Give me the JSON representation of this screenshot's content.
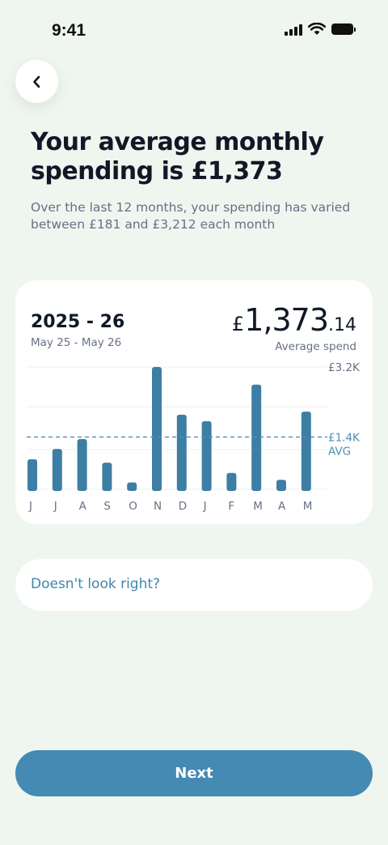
{
  "status_bar": {
    "time": "9:41"
  },
  "header": {
    "title": "Your average monthly spending is £1,373",
    "subtitle": "Over the last 12 months, your spending has varied between £181 and £3,212 each month"
  },
  "card": {
    "period_title": "2025 - 26",
    "period_range": "May 25 - May 26",
    "amount_currency": "£",
    "amount_main": "1,373",
    "amount_decimal": ".14",
    "amount_label": "Average spend"
  },
  "chart_data": {
    "type": "bar",
    "categories": [
      "J",
      "J",
      "A",
      "S",
      "O",
      "N",
      "D",
      "J",
      "F",
      "M",
      "A",
      "M"
    ],
    "values": [
      790,
      1060,
      1320,
      700,
      181,
      3212,
      1960,
      1790,
      430,
      2750,
      250,
      2040
    ],
    "average": 1373,
    "ylim": [
      0,
      3212
    ],
    "y_tick_labels": [
      "£3.2K",
      "£1.4K"
    ],
    "avg_label": "AVG",
    "bar_color": "#3d7fa4",
    "avg_line_color": "#4f8fb3",
    "grid": true
  },
  "feedback": {
    "label": "Doesn't look right?"
  },
  "footer": {
    "next_label": "Next"
  },
  "colors": {
    "background": "#eef6ef",
    "accent": "#448ab3",
    "link": "#3f87ab"
  }
}
